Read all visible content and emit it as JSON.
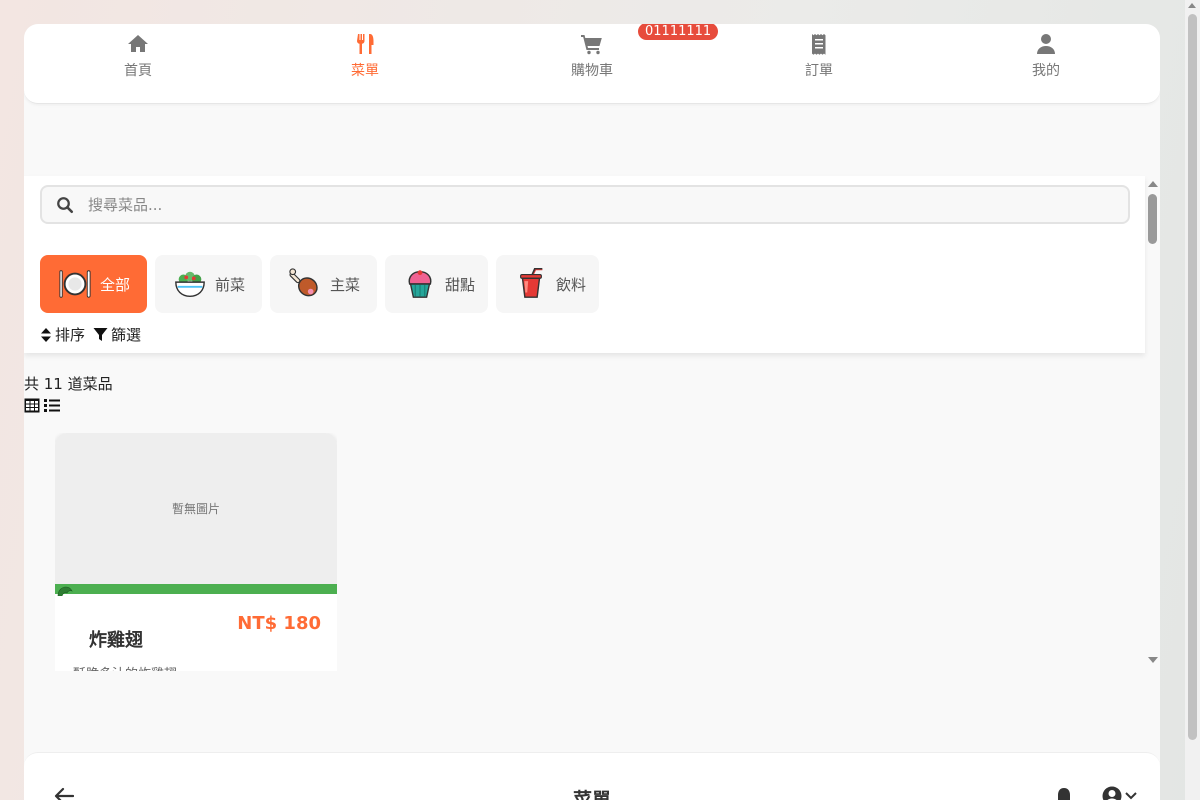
{
  "nav": {
    "items": [
      {
        "label": "首頁",
        "icon": "home-icon"
      },
      {
        "label": "菜單",
        "icon": "utensils-icon",
        "active": true
      },
      {
        "label": "購物車",
        "icon": "cart-icon",
        "badge": "01111111"
      },
      {
        "label": "訂單",
        "icon": "receipt-icon"
      },
      {
        "label": "我的",
        "icon": "user-icon"
      }
    ],
    "active_color": "#ff6b35",
    "badge_color": "#e74c3c"
  },
  "search": {
    "placeholder": "搜尋菜品..."
  },
  "categories": [
    {
      "label": "全部",
      "icon": "plate-utensils-icon",
      "active": true
    },
    {
      "label": "前菜",
      "icon": "salad-bowl-icon"
    },
    {
      "label": "主菜",
      "icon": "drumstick-icon"
    },
    {
      "label": "甜點",
      "icon": "cupcake-icon"
    },
    {
      "label": "飲料",
      "icon": "cup-with-straw-icon"
    }
  ],
  "tools": {
    "sort_label": "排序",
    "filter_label": "篩選"
  },
  "results": {
    "count_text": "共 11 道菜品"
  },
  "dishes": [
    {
      "image_placeholder": "暫無圖片",
      "name": "炸雞翅",
      "price": "NT$ 180",
      "description": "酥脆多汁的炸雞翅",
      "stripe_color": "#4caf50"
    }
  ],
  "page_header": {
    "title": "菜單"
  }
}
